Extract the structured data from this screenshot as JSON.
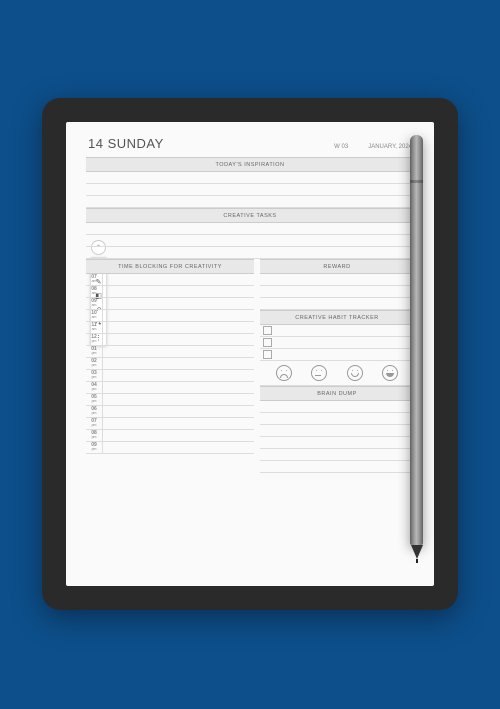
{
  "header": {
    "date": "14 SUNDAY",
    "week": "W 03",
    "month": "JANUARY, 2024"
  },
  "sections": {
    "inspiration": "TODAY'S INSPIRATION",
    "creative_tasks": "CREATIVE TASKS",
    "time_blocking": "TIME BLOCKING FOR CREATIVITY",
    "reward": "REWARD",
    "habit_tracker": "CREATIVE HABIT TRACKER",
    "brain_dump": "BRAIN DUMP"
  },
  "time_slots": [
    {
      "hr": "07",
      "ap": "am"
    },
    {
      "hr": "08",
      "ap": "am"
    },
    {
      "hr": "09",
      "ap": "am"
    },
    {
      "hr": "10",
      "ap": "am"
    },
    {
      "hr": "11",
      "ap": "am"
    },
    {
      "hr": "12",
      "ap": "pm"
    },
    {
      "hr": "01",
      "ap": "pm"
    },
    {
      "hr": "02",
      "ap": "pm"
    },
    {
      "hr": "03",
      "ap": "pm"
    },
    {
      "hr": "04",
      "ap": "pm"
    },
    {
      "hr": "05",
      "ap": "pm"
    },
    {
      "hr": "06",
      "ap": "pm"
    },
    {
      "hr": "07",
      "ap": "pm"
    },
    {
      "hr": "08",
      "ap": "pm"
    },
    {
      "hr": "09",
      "ap": "pm"
    }
  ],
  "toolbar": {
    "collapse": "⌃",
    "pen": "✎",
    "marker": "✎",
    "eraser": "◧",
    "undo": "↶",
    "redo": "↷",
    "more": "⋮"
  }
}
